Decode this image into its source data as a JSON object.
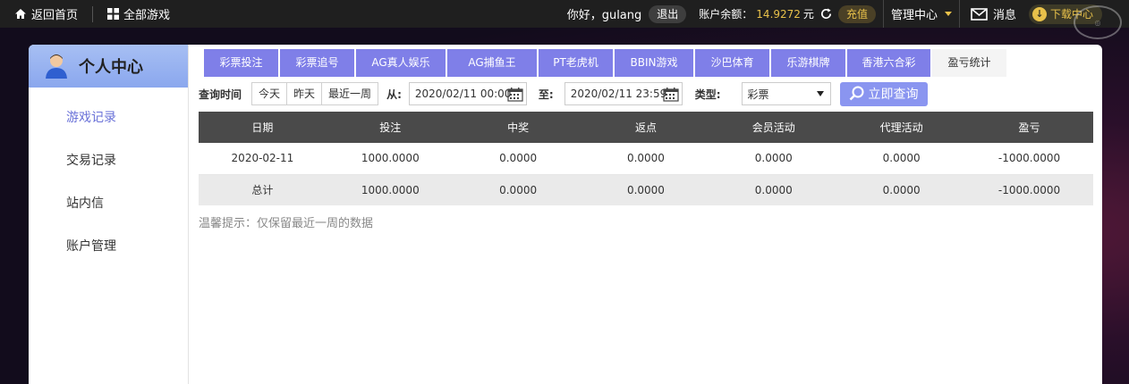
{
  "topbar": {
    "home_label": "返回首页",
    "all_games_label": "全部游戏",
    "greeting": "你好，gulang",
    "logout_label": "退出",
    "balance_label": "账户余额：",
    "balance_value": "14.9272",
    "balance_unit": "元",
    "recharge_label": "充值",
    "manage_label": "管理中心",
    "message_label": "消息",
    "download_label": "下载中心"
  },
  "sidebar": {
    "title": "个人中心",
    "items": [
      {
        "label": "游戏记录",
        "active": true
      },
      {
        "label": "交易记录",
        "active": false
      },
      {
        "label": "站内信",
        "active": false
      },
      {
        "label": "账户管理",
        "active": false
      }
    ]
  },
  "tabs": [
    {
      "label": "彩票投注",
      "active": false
    },
    {
      "label": "彩票追号",
      "active": false
    },
    {
      "label": "AG真人娱乐",
      "active": false
    },
    {
      "label": "AG捕鱼王",
      "active": false
    },
    {
      "label": "PT老虎机",
      "active": false
    },
    {
      "label": "BBIN游戏",
      "active": false
    },
    {
      "label": "沙巴体育",
      "active": false
    },
    {
      "label": "乐游棋牌",
      "active": false
    },
    {
      "label": "香港六合彩",
      "active": false
    },
    {
      "label": "盈亏统计",
      "active": true
    }
  ],
  "filters": {
    "query_time_label": "查询时间",
    "quick_ranges": [
      "今天",
      "昨天",
      "最近一周"
    ],
    "from_label": "从:",
    "from_value": "2020/02/11 00:00",
    "to_label": "至:",
    "to_value": "2020/02/11 23:59",
    "type_label": "类型:",
    "type_value": "彩票",
    "query_button": "立即查询"
  },
  "table": {
    "headers": [
      "日期",
      "投注",
      "中奖",
      "返点",
      "会员活动",
      "代理活动",
      "盈亏"
    ],
    "rows": [
      [
        "2020-02-11",
        "1000.0000",
        "0.0000",
        "0.0000",
        "0.0000",
        "0.0000",
        "-1000.0000"
      ]
    ],
    "total": [
      "总计",
      "1000.0000",
      "0.0000",
      "0.0000",
      "0.0000",
      "0.0000",
      "-1000.0000"
    ]
  },
  "hint": "温馨提示：仅保留最近一周的数据",
  "colors": {
    "accent": "#7f7fe8",
    "balance": "#e8c14a",
    "table_header": "#4a4a4a"
  }
}
